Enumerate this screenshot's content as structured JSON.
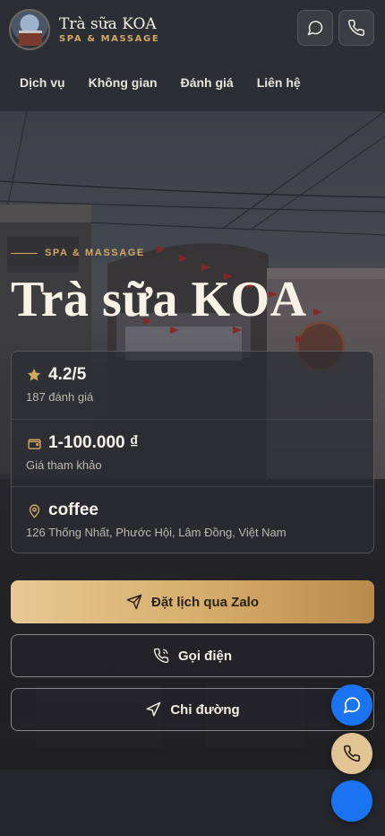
{
  "header": {
    "brand_name": "Trà sữa KOA",
    "brand_sub": "SPA & MASSAGE",
    "chat_icon": "chat-bubble-icon",
    "phone_icon": "phone-icon"
  },
  "nav": {
    "items": [
      {
        "label": "Dịch vụ"
      },
      {
        "label": "Không gian"
      },
      {
        "label": "Đánh giá"
      },
      {
        "label": "Liên hệ"
      }
    ]
  },
  "hero": {
    "eyebrow": "SPA & MASSAGE",
    "title": "Trà sữa KOA"
  },
  "info": {
    "rating": {
      "icon": "star-icon",
      "value": "4.2/5",
      "sub": "187 đánh giá"
    },
    "price": {
      "icon": "wallet-icon",
      "value": "1-100.000 ₫",
      "sub": "Giá tham khảo"
    },
    "place": {
      "icon": "map-pin-icon",
      "value": "coffee",
      "sub": "126 Thống Nhất, Phước Hội, Lâm Đồng, Việt Nam"
    }
  },
  "actions": {
    "zalo": {
      "label": "Đặt lịch qua Zalo",
      "icon": "send-icon"
    },
    "call": {
      "label": "Gọi điện",
      "icon": "phone-icon"
    },
    "directions": {
      "label": "Chi đường",
      "icon": "navigation-icon"
    }
  },
  "colors": {
    "accent_gold": "#d4a762",
    "zalo_blue": "#1a73f0",
    "background": "#25272d"
  }
}
